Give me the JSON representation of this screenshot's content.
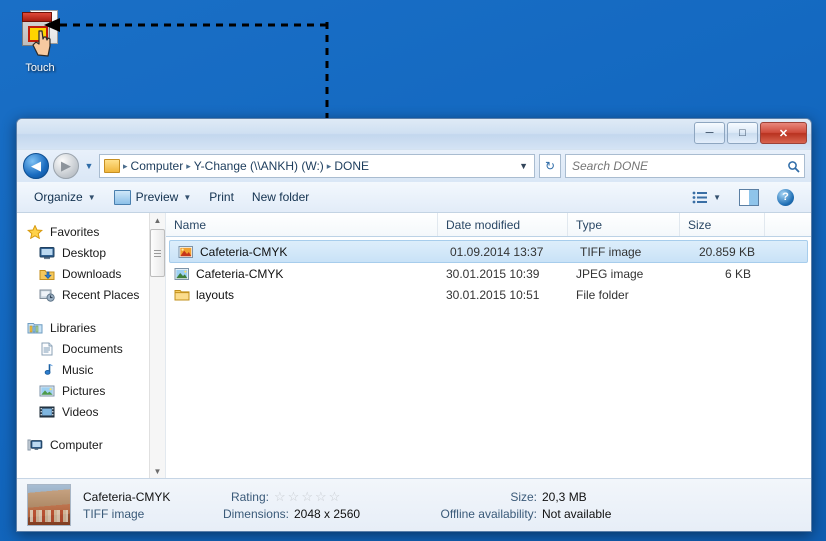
{
  "desktop": {
    "icon": {
      "label": "Touch",
      "name": "touch-shortcut"
    },
    "background_color": "#1368c0"
  },
  "annotation": {
    "type": "dashed-arrow",
    "description": "Dashed elbow arrow from selected file row to the Touch desktop icon",
    "color": "#000000"
  },
  "window": {
    "controls": {
      "minimize": "─",
      "maximize": "□",
      "close": "✕"
    },
    "address": {
      "back_label": "◀",
      "forward_label": "▶",
      "history_caret": "▼",
      "crumbs": [
        "Computer",
        "Y-Change (\\\\ANKH) (W:)",
        "DONE"
      ],
      "separator": "▸",
      "dropdown_caret": "▼",
      "refresh_label": "↻"
    },
    "search": {
      "placeholder": "Search DONE",
      "icon": "⌕"
    },
    "toolbar": {
      "organize": "Organize",
      "preview": "Preview",
      "print": "Print",
      "new_folder": "New folder",
      "caret": "▼"
    }
  },
  "sidebar": {
    "groups": [
      {
        "header": "Favorites",
        "icon": "star-icon",
        "items": [
          {
            "label": "Desktop",
            "icon": "desktop-icon"
          },
          {
            "label": "Downloads",
            "icon": "downloads-icon"
          },
          {
            "label": "Recent Places",
            "icon": "recent-places-icon"
          }
        ]
      },
      {
        "header": "Libraries",
        "icon": "libraries-icon",
        "items": [
          {
            "label": "Documents",
            "icon": "documents-icon"
          },
          {
            "label": "Music",
            "icon": "music-icon"
          },
          {
            "label": "Pictures",
            "icon": "pictures-icon"
          },
          {
            "label": "Videos",
            "icon": "videos-icon"
          }
        ]
      },
      {
        "header": "Computer",
        "icon": "computer-icon",
        "items": []
      }
    ],
    "scroll_up": "▲",
    "scroll_down": "▼"
  },
  "filelist": {
    "columns": [
      "Name",
      "Date modified",
      "Type",
      "Size"
    ],
    "rows": [
      {
        "name": "Cafeteria-CMYK",
        "date": "01.09.2014 13:37",
        "type": "TIFF image",
        "size": "20.859 KB",
        "icon": "tiff-image-icon",
        "selected": true
      },
      {
        "name": "Cafeteria-CMYK",
        "date": "30.01.2015 10:39",
        "type": "JPEG image",
        "size": "6 KB",
        "icon": "jpeg-image-icon",
        "selected": false
      },
      {
        "name": "layouts",
        "date": "30.01.2015 10:51",
        "type": "File folder",
        "size": "",
        "icon": "folder-icon",
        "selected": false
      }
    ]
  },
  "details_pane": {
    "file_name": "Cafeteria-CMYK",
    "file_type": "TIFF  image",
    "rating_label": "Rating:",
    "rating_stars": 5,
    "rating_filled": 0,
    "dimensions_label": "Dimensions:",
    "dimensions_value": "2048 x 2560",
    "size_label": "Size:",
    "size_value": "20,3 MB",
    "offline_label": "Offline availability:",
    "offline_value": "Not available"
  }
}
